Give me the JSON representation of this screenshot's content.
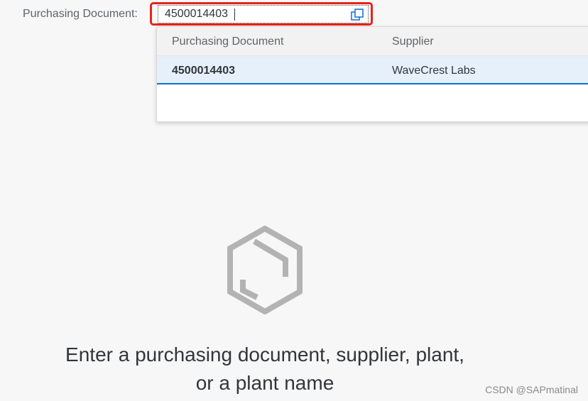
{
  "filter": {
    "label": "Purchasing Document:",
    "value": "4500014403",
    "value_help_icon": "value-help-icon"
  },
  "suggestions": {
    "columns": [
      "Purchasing Document",
      "Supplier"
    ],
    "rows": [
      {
        "document": "4500014403",
        "supplier": "WaveCrest Labs"
      }
    ]
  },
  "empty_state": {
    "icon": "box-hexagon-icon",
    "line1": "Enter a purchasing document, supplier, plant,",
    "line2": "or a plant name"
  },
  "watermark": "CSDN @SAPmatinal",
  "colors": {
    "highlight": "#e8231b",
    "selected_row": "#e5f0fa",
    "selection_line": "#0a6ed1"
  }
}
